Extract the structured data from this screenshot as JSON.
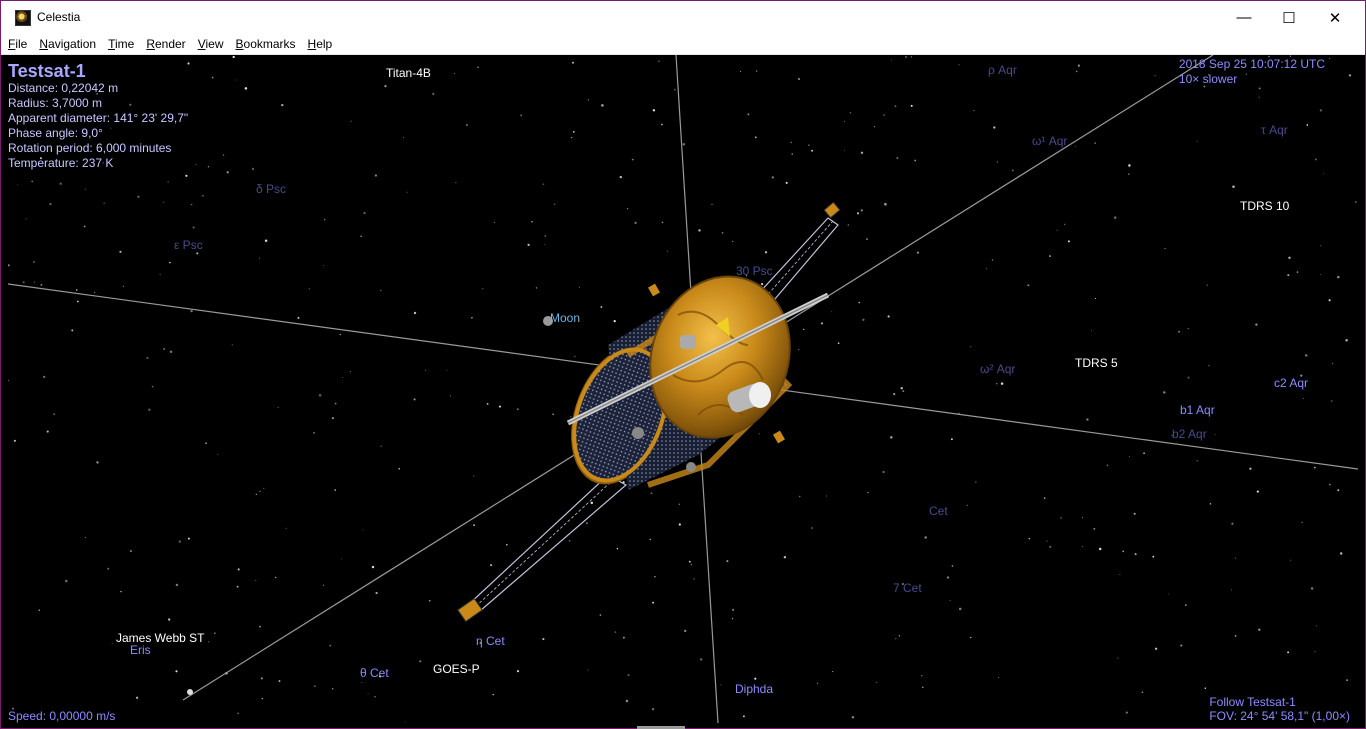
{
  "window": {
    "title": "Celestia",
    "controls": {
      "minimize": "—",
      "maximize": "☐",
      "close": "✕"
    }
  },
  "menu": [
    "File",
    "Navigation",
    "Time",
    "Render",
    "View",
    "Bookmarks",
    "Help"
  ],
  "info_panel": {
    "name": "Testsat-1",
    "distance": "Distance: 0,22042 m",
    "radius": "Radius: 3,7000 m",
    "apparent_diameter": "Apparent diameter: 141° 23' 29,7\"",
    "phase_angle": "Phase angle: 9,0°",
    "rotation_period": "Rotation period: 6,000 minutes",
    "temperature": "Temperature: 237 K"
  },
  "time_panel": {
    "datetime": "2018 Sep 25 10:07:12 UTC",
    "rate": "10× slower"
  },
  "status": {
    "speed": "Speed: 0,00000 m/s",
    "follow": "Follow Testsat-1",
    "fov": "FOV: 24° 54' 58,1\" (1,00×)"
  },
  "labels": {
    "titan4b": "Titan-4B",
    "tdrs10": "TDRS 10",
    "tdrs5": "TDRS 5",
    "moon": "Moon",
    "jwst": "James Webb ST",
    "eris": "Eris",
    "goesp": "GOES-P",
    "diphda": "Diphda",
    "eta_cet": "η Cet",
    "theta_cet": "θ Cet",
    "c2aqr": "c2 Aqr",
    "b1aqr": "b1 Aqr",
    "b2aqr": "b2 Aqr",
    "psc30": "30 Psc",
    "omega_aqr": "ω¹ Aqr",
    "rho_aqr": "ρ Aqr",
    "tau_aqr": "τ Aqr",
    "psc_d": "δ Psc",
    "psc_e": "ε Psc",
    "cet7": "7 Cet",
    "cet_mid": "Cet",
    "aqr_u": "ω² Aqr"
  },
  "colors": {
    "scene_bg": "#000000",
    "info_text": "#c8c8ff",
    "star_label": "#8c8cff",
    "dim_label": "#4a4a8a",
    "satellite_gold": "#c98a1a"
  }
}
